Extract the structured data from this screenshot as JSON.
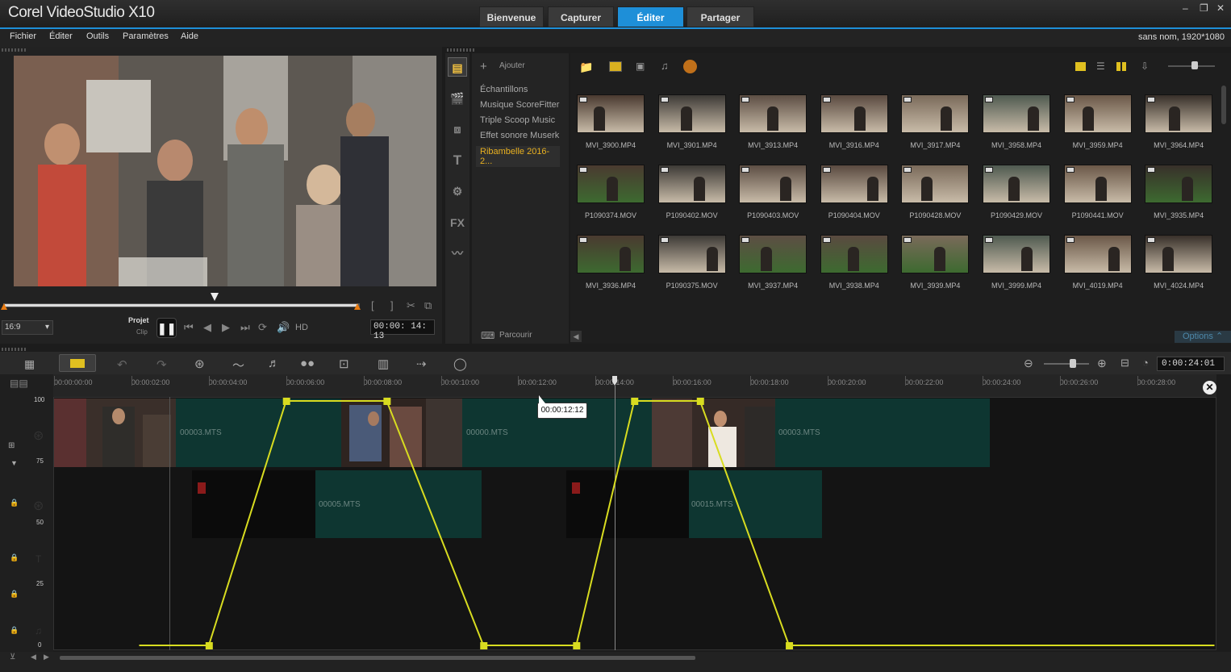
{
  "app": {
    "title": "Corel VideoStudio X10",
    "project_info": "sans nom, 1920*1080"
  },
  "tabs": [
    {
      "label": "Bienvenue",
      "active": false
    },
    {
      "label": "Capturer",
      "active": false
    },
    {
      "label": "Éditer",
      "active": true
    },
    {
      "label": "Partager",
      "active": false
    }
  ],
  "menu": [
    "Fichier",
    "Éditer",
    "Outils",
    "Paramètres",
    "Aide"
  ],
  "preview": {
    "aspect": "16:9",
    "mode_project": "Projet",
    "mode_clip": "Clip",
    "hd": "HD",
    "timecode": "00:00: 14: 13"
  },
  "library": {
    "add_label": "Ajouter",
    "browse_label": "Parcourir",
    "options_label": "Options",
    "folders": [
      "Échantillons",
      "Musique ScoreFitter",
      "Triple Scoop Music",
      "Effet sonore Muserk",
      "Ribambelle 2016-2..."
    ],
    "active_folder": 4,
    "clips": [
      "MVI_3900.MP4",
      "MVI_3901.MP4",
      "MVI_3913.MP4",
      "MVI_3916.MP4",
      "MVI_3917.MP4",
      "MVI_3958.MP4",
      "MVI_3959.MP4",
      "MVI_3964.MP4",
      "P1090374.MOV",
      "P1090402.MOV",
      "P1090403.MOV",
      "P1090404.MOV",
      "P1090428.MOV",
      "P1090429.MOV",
      "P1090441.MOV",
      "MVI_3935.MP4",
      "MVI_3936.MP4",
      "P1090375.MOV",
      "MVI_3937.MP4",
      "MVI_3938.MP4",
      "MVI_3939.MP4",
      "MVI_3999.MP4",
      "MVI_4019.MP4",
      "MVI_4024.MP4"
    ]
  },
  "timeline": {
    "duration": "0:00:24:01",
    "ruler": [
      "00:00:00:00",
      "00:00:02:00",
      "00:00:04:00",
      "00:00:06:00",
      "00:00:08:00",
      "00:00:10:00",
      "00:00:12:00",
      "00:00:14:00",
      "00:00:16:00",
      "00:00:18:00",
      "00:00:20:00",
      "00:00:22:00",
      "00:00:24:00",
      "00:00:26:00",
      "00:00:28:00"
    ],
    "tooltip": "00:00:12:12",
    "yaxis": [
      "100",
      "75",
      "50",
      "25",
      "0"
    ],
    "clips_track1": [
      "00003.MTS",
      "00000.MTS",
      "00003.MTS"
    ],
    "clips_track2": [
      "00005.MTS",
      "00015.MTS"
    ],
    "opacity_keyframes": [
      {
        "t": 2.2,
        "v": 0
      },
      {
        "t": 2.3,
        "v": 0
      },
      {
        "t": 4.0,
        "v": 0
      },
      {
        "t": 6.0,
        "v": 100
      },
      {
        "t": 8.6,
        "v": 100
      },
      {
        "t": 11.1,
        "v": 0
      },
      {
        "t": 13.5,
        "v": 0
      },
      {
        "t": 15.0,
        "v": 100
      },
      {
        "t": 16.7,
        "v": 100
      },
      {
        "t": 19.0,
        "v": 0
      },
      {
        "t": 30.0,
        "v": 0
      }
    ]
  },
  "colors": {
    "accent": "#1e8fd8",
    "keyframe": "#d8dc20",
    "clip_teal": "#0f3a35"
  }
}
